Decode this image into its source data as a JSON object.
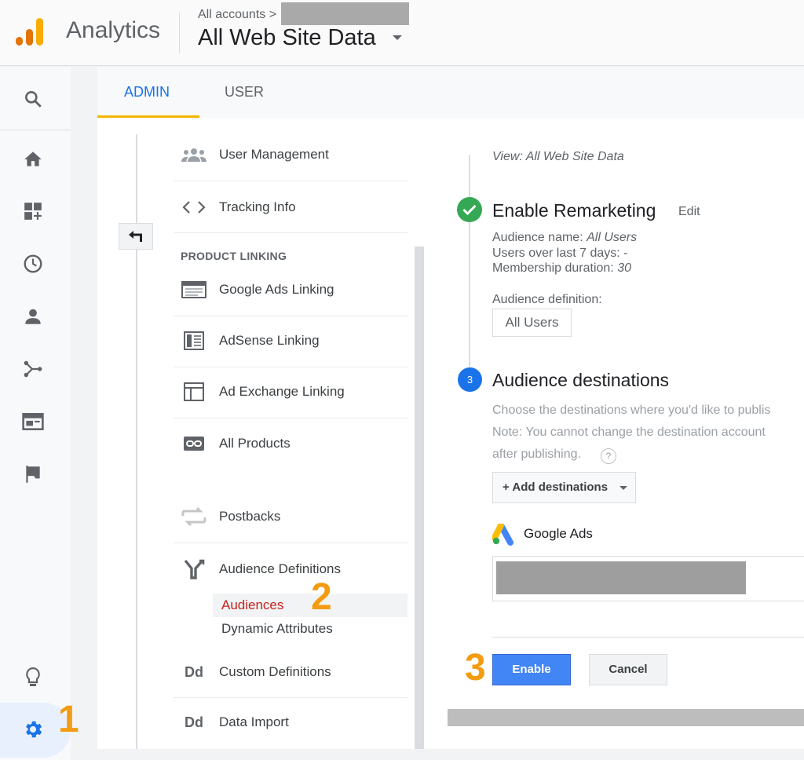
{
  "header": {
    "app_title": "Analytics",
    "breadcrumb": "All accounts >",
    "view_title": "All Web Site Data"
  },
  "tabs": [
    {
      "label": "ADMIN",
      "active": true
    },
    {
      "label": "USER",
      "active": false
    }
  ],
  "left_nav": {
    "icons": [
      "search-icon",
      "home-icon",
      "customization-icon",
      "realtime-clock-icon",
      "audience-person-icon",
      "acquisition-icon",
      "behavior-icon",
      "conversions-flag-icon",
      "discover-lightbulb-icon",
      "admin-gear-icon"
    ]
  },
  "menu": {
    "items": [
      {
        "label": "User Management",
        "icon": "users-icon"
      },
      {
        "label": "Tracking Info",
        "icon": "code-icon"
      }
    ],
    "section_title": "PRODUCT LINKING",
    "linking_items": [
      {
        "label": "Google Ads Linking",
        "icon": "ads-linking-icon"
      },
      {
        "label": "AdSense Linking",
        "icon": "adsense-icon"
      },
      {
        "label": "Ad Exchange Linking",
        "icon": "ad-exchange-icon"
      },
      {
        "label": "All Products",
        "icon": "link-icon"
      }
    ],
    "other_items": [
      {
        "label": "Postbacks",
        "icon": "postbacks-icon"
      },
      {
        "label": "Audience Definitions",
        "icon": "audience-definitions-icon"
      }
    ],
    "sub_items": [
      {
        "label": "Audiences",
        "active": true
      },
      {
        "label": "Dynamic Attributes",
        "active": false
      }
    ],
    "bottom_items": [
      {
        "label": "Custom Definitions",
        "icon": "dd-icon",
        "glyph": "Dd"
      },
      {
        "label": "Data Import",
        "icon": "dd-icon",
        "glyph": "Dd"
      }
    ]
  },
  "markers": {
    "one": "1",
    "two": "2",
    "three": "3"
  },
  "remarketing": {
    "view_line": "View: All Web Site Data",
    "step1_title": "Enable Remarketing",
    "edit": "Edit",
    "audience_name_label": "Audience name:",
    "audience_name_value": "All Users",
    "users_over_label": "Users over last 7 days: -",
    "membership_label": "Membership duration:",
    "membership_value": "30",
    "audience_definition_label": "Audience definition:",
    "audience_definition_value": "All Users",
    "step2_number": "3",
    "step2_title": "Audience destinations",
    "desc_line1": "Choose the destinations where you'd like to publis",
    "desc_line2": "Note: You cannot change the destination account",
    "desc_line3": "after publishing.",
    "help": "?",
    "add_destinations": "+ Add destinations",
    "google_ads_label": "Google Ads",
    "enable_button": "Enable",
    "cancel_button": "Cancel"
  },
  "colors": {
    "accent_blue": "#1a73e8",
    "tab_underline": "#f4b400",
    "marker_orange": "#f39c12",
    "success_green": "#34a853",
    "active_red": "#c5221f"
  }
}
